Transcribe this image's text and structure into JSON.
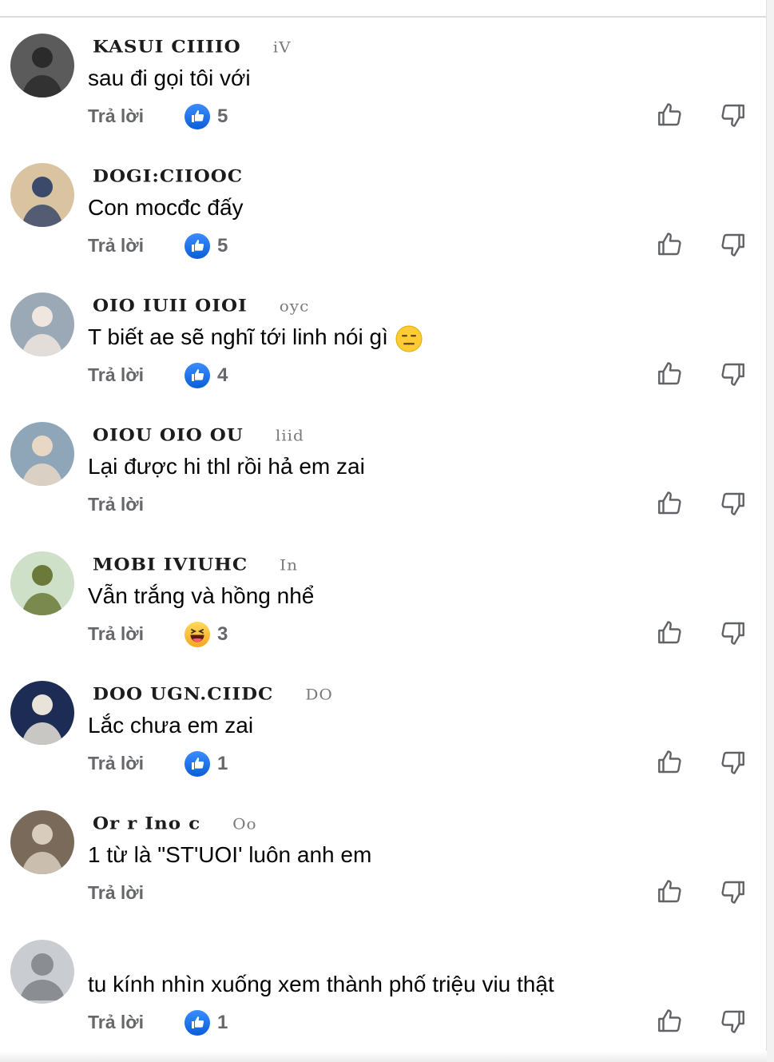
{
  "comments": [
    {
      "author": "KASUI CIIIIO",
      "author_tail": "iV",
      "text": "sau đi gọi tôi với",
      "reply_label": "Trả lời",
      "reaction": {
        "type": "like",
        "count": "5"
      },
      "avatar": {
        "bg": "#5b5b5b",
        "accent": "#2b2b2b"
      }
    },
    {
      "author": "DOGI:CIIOOC",
      "author_tail": "",
      "text": "Con mocđc đấy",
      "reply_label": "Trả lời",
      "reaction": {
        "type": "like",
        "count": "5"
      },
      "avatar": {
        "bg": "#d9c3a0",
        "accent": "#3b4a6b"
      }
    },
    {
      "author": "OIO IUII OIOI",
      "author_tail": "oyc",
      "text": "T biết ae sẽ nghĩ tới linh nói gì",
      "emoji": "expressionless-face",
      "reply_label": "Trả lời",
      "reaction": {
        "type": "like",
        "count": "4"
      },
      "avatar": {
        "bg": "#9aa9b5",
        "accent": "#f0e6e0"
      }
    },
    {
      "author": "OIOU OIO OU",
      "author_tail": "liid",
      "text": "Lại được hi thl rồi hả em zai",
      "reply_label": "Trả lời",
      "reaction": null,
      "avatar": {
        "bg": "#8fa6b8",
        "accent": "#e8d7c5"
      }
    },
    {
      "author": "MOBI IVIUHC",
      "author_tail": "In",
      "text": "Vẫn trắng và hồng nhể",
      "reply_label": "Trả lời",
      "reaction": {
        "type": "haha",
        "count": "3"
      },
      "avatar": {
        "bg": "#cfe0c8",
        "accent": "#6b7a3a"
      }
    },
    {
      "author": "DOO UGN.CIIDC",
      "author_tail": "DO",
      "text": "Lắc chưa em zai",
      "reply_label": "Trả lời",
      "reaction": {
        "type": "like",
        "count": "1"
      },
      "avatar": {
        "bg": "#1c2c55",
        "accent": "#e8e3d8"
      }
    },
    {
      "author": "Or r Ino c",
      "author_tail": "Oo",
      "text": "1 từ là \"ST'UOI' luôn anh em",
      "reply_label": "Trả lời",
      "reaction": null,
      "avatar": {
        "bg": "#7a6a5a",
        "accent": "#d8cdbd"
      }
    },
    {
      "author": "",
      "author_tail": "",
      "text": "tu  kính nhìn xuống xem thành phố triệu viu thật",
      "reply_label": "Trả lời",
      "reaction": {
        "type": "like",
        "count": "1"
      },
      "avatar": {
        "bg": "#c9ccd1",
        "accent": "#8a8d91",
        "default": true
      }
    }
  ],
  "colors": {
    "like_blue": "#1877f2",
    "secondary_text": "#65676b",
    "primary_text": "#050505",
    "icon_gray": "#606266"
  },
  "icons": {
    "like_button": "thumbs-up-outline-icon",
    "dislike_button": "thumbs-down-outline-icon",
    "like_reaction": "like-reaction-icon",
    "haha_reaction": "haha-reaction-icon"
  }
}
